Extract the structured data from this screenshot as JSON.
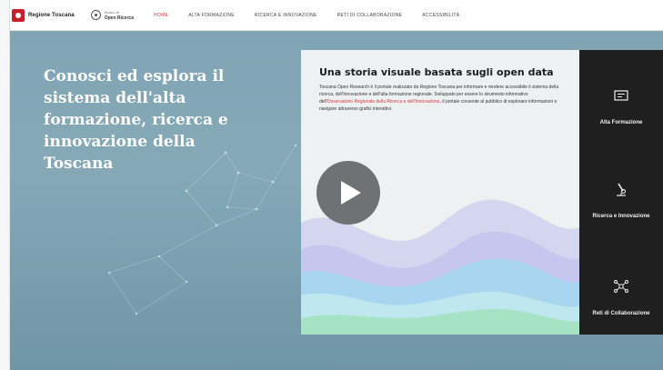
{
  "header": {
    "regione_label": "Regione Toscana",
    "osr_small": "Museo di",
    "osr_big": "Open Ricerca",
    "nav": [
      {
        "label": "HOME",
        "active": true
      },
      {
        "label": "ALTA FORMAZIONE",
        "active": false
      },
      {
        "label": "RICERCA E INNOVAZIONE",
        "active": false
      },
      {
        "label": "RETI DI COLLABORAZIONE",
        "active": false
      },
      {
        "label": "ACCESSIBILITÀ",
        "active": false
      }
    ]
  },
  "hero": {
    "title": "Conosci ed esplora il sistema dell'alta formazione, ricerca e innovazione della Toscana"
  },
  "story": {
    "title": "Una storia visuale basata sugli open data",
    "body_prefix": "Toscana Open Research è il portale realizzato da Regione Toscana per informare e rendere accessibile il sistema della ricerca, dell'innovazione e dell'alta formazione regionale. Sviluppato per essere lo strumento informativo dell'",
    "body_link": "Osservatorio Regionale della Ricerca e dell'Innovazione",
    "body_suffix": ", il portale consente al pubblico di esplorare informazioni e navigare attraverso grafici interattivi."
  },
  "sections": [
    {
      "label": "Alta Formazione",
      "icon": "diploma-icon"
    },
    {
      "label": "Ricerca e Innovazione",
      "icon": "microscope-icon"
    },
    {
      "label": "Reti di Collaborazione",
      "icon": "network-icon"
    }
  ],
  "colors": {
    "accent": "#d9363e",
    "background": "#7fa3b3",
    "dark_panel": "#1f1f1f"
  }
}
